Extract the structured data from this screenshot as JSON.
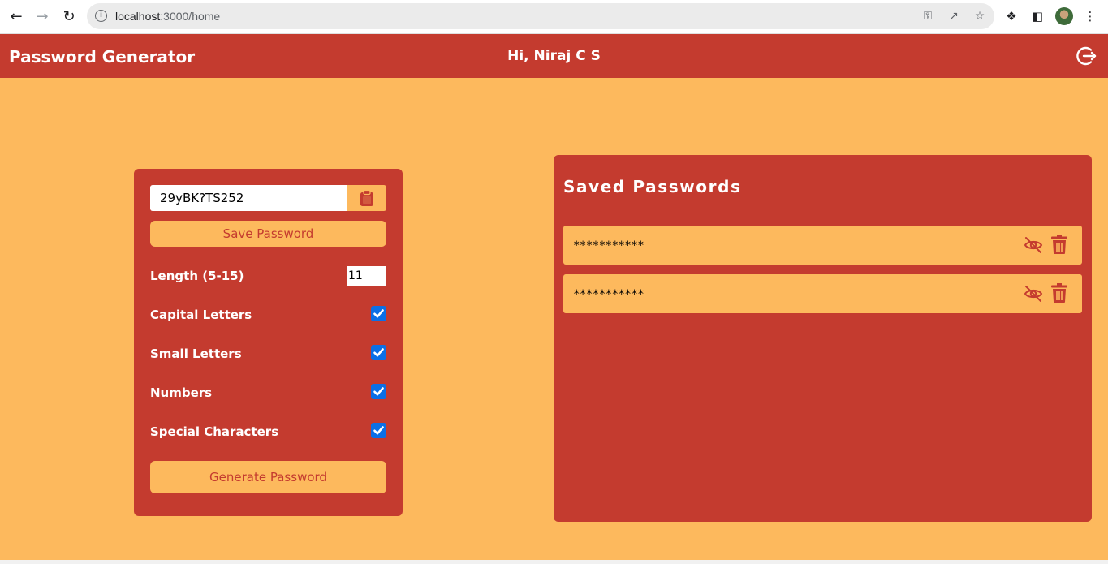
{
  "browser": {
    "url_host": "localhost",
    "url_rest": ":3000/home"
  },
  "header": {
    "brand": "Password Generator",
    "greeting": "Hi, Niraj C S"
  },
  "generator": {
    "password_value": "29yBK?TS252",
    "save_label": "Save Password",
    "length_label": "Length (5-15)",
    "length_value": "11",
    "options": [
      {
        "label": "Capital Letters",
        "checked": true
      },
      {
        "label": "Small Letters",
        "checked": true
      },
      {
        "label": "Numbers",
        "checked": true
      },
      {
        "label": "Special Characters",
        "checked": true
      }
    ],
    "generate_label": "Generate Password"
  },
  "saved": {
    "title": "Saved Passwords",
    "items": [
      {
        "masked": "***********"
      },
      {
        "masked": "***********"
      }
    ]
  },
  "colors": {
    "background": "#fdb95d",
    "primary": "#c43b2f",
    "checkbox": "#0b6fe6"
  }
}
